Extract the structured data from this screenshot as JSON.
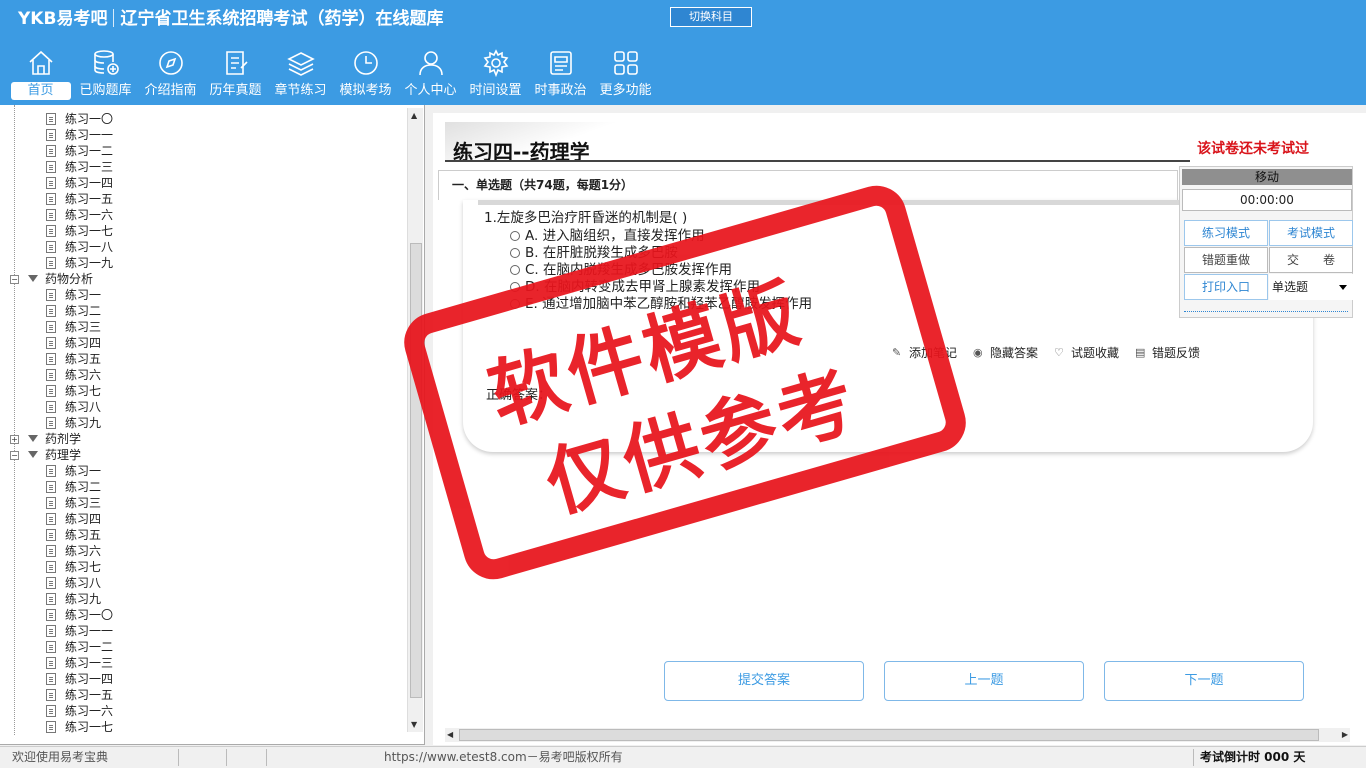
{
  "header": {
    "logo": "YKB易考吧",
    "title": "辽宁省卫生系统招聘考试（药学）在线题库",
    "switch_label": "切换科目"
  },
  "nav": [
    {
      "label": "首页",
      "icon": "home-icon"
    },
    {
      "label": "已购题库",
      "icon": "database-icon"
    },
    {
      "label": "介绍指南",
      "icon": "compass-icon"
    },
    {
      "label": "历年真题",
      "icon": "list-icon"
    },
    {
      "label": "章节练习",
      "icon": "layers-icon"
    },
    {
      "label": "模拟考场",
      "icon": "clock-icon"
    },
    {
      "label": "个人中心",
      "icon": "user-icon"
    },
    {
      "label": "时间设置",
      "icon": "gear-icon"
    },
    {
      "label": "时事政治",
      "icon": "news-icon"
    },
    {
      "label": "更多功能",
      "icon": "grid-icon"
    }
  ],
  "tree": [
    {
      "type": "child",
      "label": "练习一〇"
    },
    {
      "type": "child",
      "label": "练习一一"
    },
    {
      "type": "child",
      "label": "练习一二"
    },
    {
      "type": "child",
      "label": "练习一三"
    },
    {
      "type": "child",
      "label": "练习一四"
    },
    {
      "type": "child",
      "label": "练习一五"
    },
    {
      "type": "child",
      "label": "练习一六"
    },
    {
      "type": "child",
      "label": "练习一七"
    },
    {
      "type": "child",
      "label": "练习一八"
    },
    {
      "type": "child",
      "label": "练习一九"
    },
    {
      "type": "parent",
      "label": "药物分析",
      "expander": "−"
    },
    {
      "type": "child",
      "label": "练习一"
    },
    {
      "type": "child",
      "label": "练习二"
    },
    {
      "type": "child",
      "label": "练习三"
    },
    {
      "type": "child",
      "label": "练习四"
    },
    {
      "type": "child",
      "label": "练习五"
    },
    {
      "type": "child",
      "label": "练习六"
    },
    {
      "type": "child",
      "label": "练习七"
    },
    {
      "type": "child",
      "label": "练习八"
    },
    {
      "type": "child",
      "label": "练习九"
    },
    {
      "type": "parent",
      "label": "药剂学",
      "expander": "+"
    },
    {
      "type": "parent",
      "label": "药理学",
      "expander": "−"
    },
    {
      "type": "child",
      "label": "练习一"
    },
    {
      "type": "child",
      "label": "练习二"
    },
    {
      "type": "child",
      "label": "练习三"
    },
    {
      "type": "child",
      "label": "练习四"
    },
    {
      "type": "child",
      "label": "练习五"
    },
    {
      "type": "child",
      "label": "练习六"
    },
    {
      "type": "child",
      "label": "练习七"
    },
    {
      "type": "child",
      "label": "练习八"
    },
    {
      "type": "child",
      "label": "练习九"
    },
    {
      "type": "child",
      "label": "练习一〇"
    },
    {
      "type": "child",
      "label": "练习一一"
    },
    {
      "type": "child",
      "label": "练习一二"
    },
    {
      "type": "child",
      "label": "练习一三"
    },
    {
      "type": "child",
      "label": "练习一四"
    },
    {
      "type": "child",
      "label": "练习一五"
    },
    {
      "type": "child",
      "label": "练习一六"
    },
    {
      "type": "child",
      "label": "练习一七"
    }
  ],
  "paper": {
    "title": "练习四--药理学",
    "status": "该试卷还未考试过",
    "section": "一、单选题（共74题，每题1分）"
  },
  "question": {
    "text": "1.左旋多巴治疗肝昏迷的机制是( )",
    "options": [
      "A. 进入脑组织，直接发挥作用",
      "B. 在肝脏脱羧生成多巴胺",
      "C. 在脑内脱羧生成多巴胺发挥作用",
      "D. 在脑内转变成去甲肾上腺素发挥作用",
      "E. 通过增加脑中苯乙醇胺和羟苯乙醇胺发挥作用"
    ],
    "answer_label": "正确答案："
  },
  "tools": [
    {
      "label": "添加笔记",
      "icon": "pencil-icon"
    },
    {
      "label": "隐藏答案",
      "icon": "eye-icon"
    },
    {
      "label": "试题收藏",
      "icon": "heart-icon"
    },
    {
      "label": "错题反馈",
      "icon": "feedback-icon"
    }
  ],
  "panel": {
    "head": "移动",
    "timer": "00:00:00",
    "practice_mode": "练习模式",
    "exam_mode": "考试模式",
    "redo_wrong": "错题重做",
    "submit": "交　　卷",
    "print": "打印入口",
    "type_select": "单选题"
  },
  "buttons": {
    "submit_answer": "提交答案",
    "prev": "上一题",
    "next": "下一题"
  },
  "status": {
    "welcome": "欢迎使用易考宝典",
    "copyright": "https://www.etest8.com－易考吧版权所有",
    "countdown": "考试倒计时 000 天"
  },
  "watermark": {
    "line1": "软件模版",
    "line2": "仅供参考"
  },
  "colors": {
    "header": "#3c9be3",
    "stamp": "#e8141c",
    "status_red": "#d9141b"
  }
}
